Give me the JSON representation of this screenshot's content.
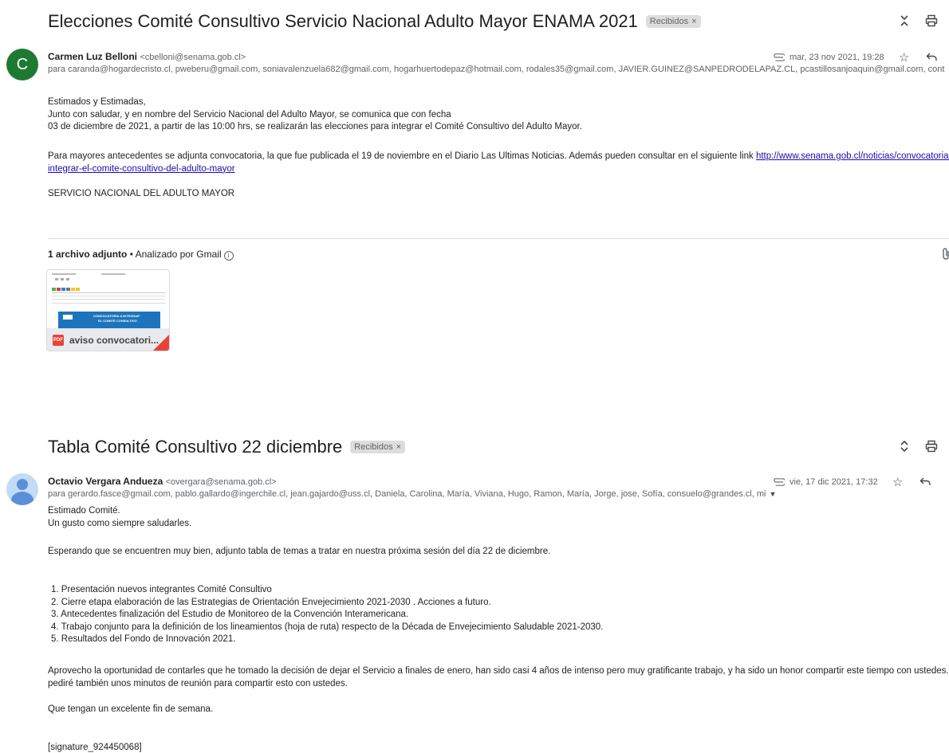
{
  "thread1": {
    "subject": "Elecciones Comité Consultivo Servicio Nacional Adulto Mayor ENAMA 2021",
    "label": "Recibidos",
    "label_close": "×",
    "avatar_letter": "C",
    "sender_name": "Carmen Luz Belloni",
    "sender_email": "<cbelloni@senama.gob.cl>",
    "recipients": "para caranda@hogardecristo.cl, pweberu@gmail.com, soniavalenzuela682@gmail.com, hogarhuertodepaz@hotmail.com, rodales35@gmail.com, JAVIER.GUINEZ@SANPEDRODELAPAZ.CL, pcastillosanjoaquin@gmail.com, cont",
    "date": "mar, 23 nov 2021, 19:28",
    "body": [
      "Estimados y Estimadas,",
      "Junto con saludar, y en nombre del Servicio Nacional del Adulto Mayor, se comunica que con fecha",
      "03 de diciembre de 2021,  a  partir de las  10:00 hrs, se realizarán las elecciones para integrar el Comité Consultivo del Adulto Mayor."
    ],
    "para2_text": "Para mayores antecedentes se adjunta convocatoria, la que fue publicada el 19 de noviembre en el  Diario Las Ultimas Noticias. Además pueden consultar en el siguiente  link ",
    "link_part1": "http://www.senama.gob.cl/noticias/convocatoria-para-",
    "link_part2": "integrar-el-comite-consultivo-del-adulto-mayor",
    "signoff": "SERVICIO NACIONAL DEL ADULTO MAYOR",
    "attachments_count": "1 archivo adjunto",
    "attachments_scanned": " • Analizado por Gmail",
    "attachment_name": "aviso convocatori...",
    "attachment_type": "PDF",
    "thumb_banner_line1": "CONVOCATORIA A INTEGRAR",
    "thumb_banner_line2": "EL COMITÉ CONSULTIVO"
  },
  "thread2": {
    "subject": "Tabla Comité Consultivo 22 diciembre",
    "label": "Recibidos",
    "label_close": "×",
    "sender_name": "Octavio Vergara Andueza",
    "sender_email": "<overgara@senama.gob.cl>",
    "recipients": "para gerardo.fasce@gmail.com, pablo.gallardo@ingerchile.cl, jean.gajardo@uss.cl, Daniela, Carolina, María, Viviana, Hugo, Ramon, María, Jorge, jose, Sofía, consuelo@grandes.cl, mi",
    "date": "vie, 17 dic 2021, 17:32",
    "greeting": "Estimado Comité.",
    "greeting2": "Un gusto como siempre saludarles.",
    "intro": "Esperando que se encuentren muy bien, adjunto tabla de temas a tratar en nuestra próxima sesión del día 22 de diciembre.",
    "agenda": [
      "1.  Presentación nuevos integrantes Comité Consultivo",
      "2.  Cierre etapa elaboración de las Estrategias de Orientación Envejecimiento 2021-2030 . Acciones a futuro.",
      "3.  Antecedentes finalización del Estudio de Monitoreo de la Convención Interamericana.",
      "4.  Trabajo conjunto para la definición de los lineamientos (hoja de ruta) respecto de la Década de Envejecimiento Saludable 2021-2030.",
      "5.  Resultados del Fondo de Innovación 2021."
    ],
    "closing1": "Aprovecho la oportunidad de contarles que he tomado la decisión de dejar el Servicio a finales de enero, han sido casi 4 años de intenso pero muy gratificante trabajo, y ha sido un honor compartir este tiempo con ustedes. Les",
    "closing2": "pediré también unos minutos de reunión para compartir esto con ustedes.",
    "weekend": "Que tengan un excelente fin de semana.",
    "signature": "[signature_924450068]"
  },
  "icons": {
    "collapse": "collapse-icon",
    "expand": "expand-icon",
    "print": "print-icon",
    "open_new": "open-in-new-window-icon",
    "attachment": "paperclip-icon",
    "star": "star-icon",
    "reply": "reply-icon",
    "more": "more-vertical-icon",
    "info": "info-icon"
  },
  "colors": {
    "link": "#1a0dab",
    "avatar_green": "#1e7a32",
    "pdf_red": "#ea4335",
    "chip_bg": "#dddddd"
  }
}
